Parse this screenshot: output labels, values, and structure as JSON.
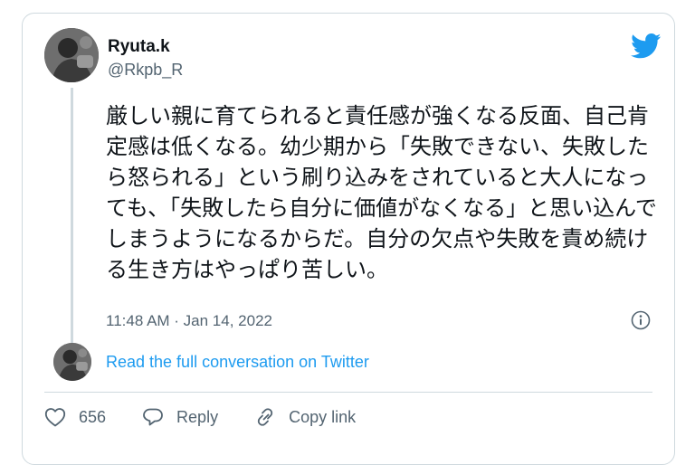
{
  "user": {
    "name": "Ryuta.k",
    "handle": "@Rkpb_R"
  },
  "tweet": {
    "text": "厳しい親に育てられると責任感が強くなる反面、自己肯定感は低くなる。幼少期から「失敗できない、失敗したら怒られる」という刷り込みをされていると大人になっても、「失敗したら自分に価値がなくなる」と思い込んでしまうようになるからだ。自分の欠点や失敗を責め続ける生き方はやっぱり苦しい。",
    "timestamp": "11:48 AM · Jan 14, 2022"
  },
  "conversation_link": "Read the full conversation on Twitter",
  "actions": {
    "like_count": "656",
    "reply_label": "Reply",
    "copy_link_label": "Copy link"
  },
  "icons": {
    "brand": "twitter-bird-icon",
    "info": "info-icon",
    "like": "heart-icon",
    "reply": "reply-bubble-icon",
    "copy": "link-icon"
  },
  "colors": {
    "brand_blue": "#1d9bf0",
    "text_primary": "#0f1419",
    "text_secondary": "#536471",
    "border": "#cfd9de"
  }
}
